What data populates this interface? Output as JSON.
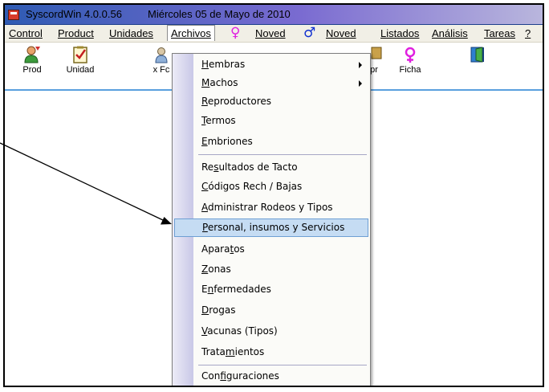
{
  "window": {
    "title": "SyscordWin 4.0.0.56",
    "date": "Miércoles 05 de Mayo de 2010"
  },
  "menubar": {
    "items": [
      {
        "label": "Control"
      },
      {
        "label": "Product"
      },
      {
        "label": "Unidades"
      },
      {
        "label": "Archivos"
      },
      {
        "label": "Noved"
      },
      {
        "label": "Noved"
      },
      {
        "label": "Listados"
      },
      {
        "label": "Análisis"
      },
      {
        "label": "Tareas"
      },
      {
        "label": "?"
      }
    ],
    "female_symbol": "♀",
    "male_symbol": "♂",
    "female_color": "#e020e0",
    "male_color": "#1030d0"
  },
  "toolbar": {
    "buttons": [
      {
        "label": "Prod",
        "icon": "person-icon"
      },
      {
        "label": "Unidad",
        "icon": "checklist-icon"
      },
      {
        "label": "x Fc",
        "icon": "person-icon"
      },
      {
        "label": "pr",
        "icon": "product-icon"
      },
      {
        "label": "Ficha",
        "icon": "female-symbol-icon"
      },
      {
        "label": "",
        "icon": "exit-door-icon"
      }
    ]
  },
  "dropdown": {
    "items": [
      {
        "pre": "",
        "u": "H",
        "post": "embras",
        "submenu": true
      },
      {
        "pre": "",
        "u": "M",
        "post": "achos",
        "submenu": true
      },
      {
        "pre": "",
        "u": "R",
        "post": "eproductores"
      },
      {
        "pre": "",
        "u": "T",
        "post": "ermos"
      },
      {
        "pre": "",
        "u": "E",
        "post": "mbriones"
      },
      {
        "pre": "Re",
        "u": "s",
        "post": "ultados de Tacto"
      },
      {
        "pre": "",
        "u": "C",
        "post": "ódigos Rech / Bajas"
      },
      {
        "pre": "",
        "u": "A",
        "post": "dministrar Rodeos y Tipos"
      },
      {
        "pre": "",
        "u": "P",
        "post": "ersonal, insumos y Servicios",
        "highlighted": true
      },
      {
        "pre": "Apara",
        "u": "t",
        "post": "os"
      },
      {
        "pre": "",
        "u": "Z",
        "post": "onas"
      },
      {
        "pre": "E",
        "u": "n",
        "post": "fermedades"
      },
      {
        "pre": "",
        "u": "D",
        "post": "rogas"
      },
      {
        "pre": "",
        "u": "V",
        "post": "acunas (Tipos)"
      },
      {
        "pre": "Trata",
        "u": "m",
        "post": "ientos"
      },
      {
        "pre": "Con",
        "u": "f",
        "post": "iguraciones"
      }
    ],
    "highlight_color": "#c5dcf3"
  }
}
